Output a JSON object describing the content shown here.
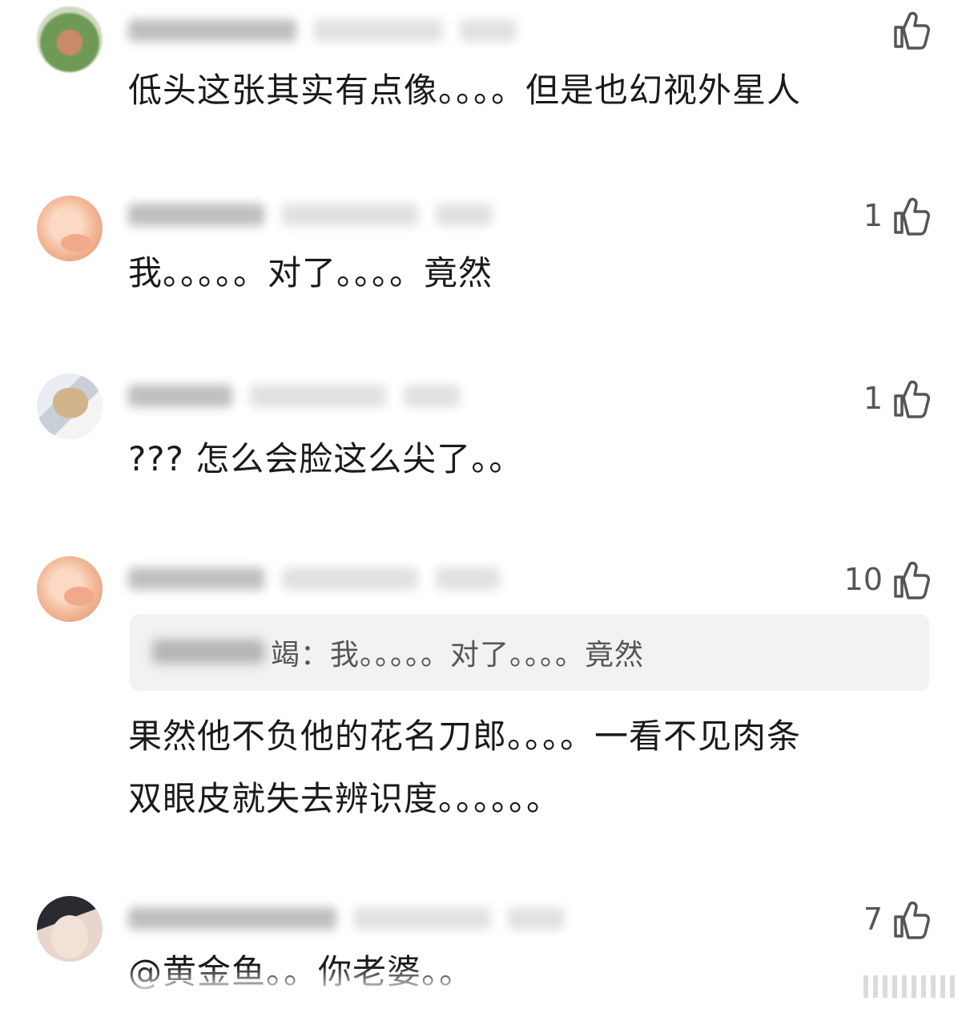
{
  "comments": [
    {
      "likes": "",
      "text": "低头这张其实有点像。。。。但是也幻视外星人"
    },
    {
      "likes": "1",
      "text": "我。。。。。对了。。。。竟然"
    },
    {
      "likes": "1",
      "text": "??? 怎么会脸这么尖了。。"
    },
    {
      "likes": "10",
      "quote": {
        "text": "竭：我。。。。。对了。。。。竟然"
      },
      "text": "果然他不负他的花名刀郎。。。。一看不见肉条\n双眼皮就失去辨识度。。。。。。"
    },
    {
      "likes": "7",
      "text": "@黄金鱼。。你老婆。。"
    }
  ],
  "icons": {
    "avatar_1": "flower-avatar-icon",
    "avatar_2": "clay-pig-avatar-icon",
    "avatar_3": "cat-avatar-icon",
    "avatar_4": "clay-pig-avatar-icon",
    "avatar_5": "person-avatar-icon",
    "like": "thumbs-up-icon"
  }
}
